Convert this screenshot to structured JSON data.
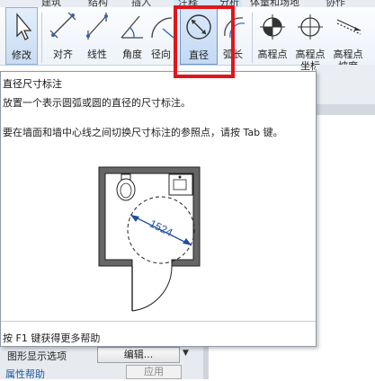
{
  "ribbon_tabs": [
    "建筑",
    "结构",
    "插入",
    "注释",
    "分析",
    "体量和场地",
    "协作"
  ],
  "ribbon": {
    "modify": "修改",
    "align": "对齐",
    "linear": "线性",
    "angular": "角度",
    "radial": "径向",
    "diameter": "直径",
    "arc_length": "弧长",
    "spot_elevation": "高程点",
    "spot_coordinate_l1": "高程点",
    "spot_coordinate_l2": "坐标",
    "spot_slope_l1": "高程点",
    "spot_slope_l2": "坡度"
  },
  "tooltip": {
    "title": "直径尺寸标注",
    "description": "放置一个表示圆弧或圆的直径的尺寸标注。",
    "tip": "要在墙面和墙中心线之间切换尺寸标注的参照点，请按 Tab 键。",
    "illustration_value": "1524",
    "footer": "按 F1 键获得更多帮助"
  },
  "properties_panel": {
    "graphic_display_label": "图形显示选项",
    "edit_button": "编辑...",
    "help_link": "属性帮助",
    "apply_button": "应用"
  },
  "colors": {
    "highlight": "#e0161c",
    "dimension_blue": "#1f4fa0",
    "selected_tool_bg": "#c3d9f4"
  }
}
